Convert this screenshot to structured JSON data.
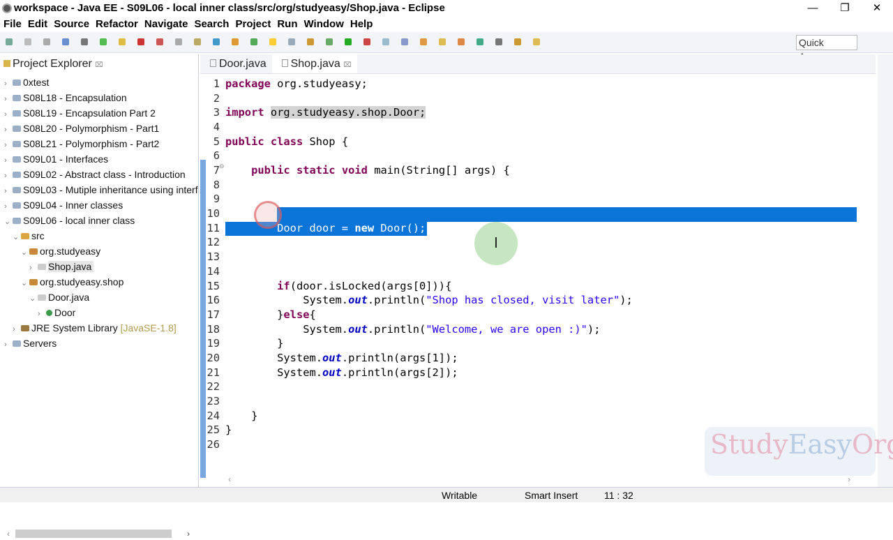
{
  "window": {
    "title": "workspace - Java EE - S09L06 - local inner class/src/org/studyeasy/Shop.java - Eclipse",
    "minimize": "—",
    "maximize": "❐",
    "close": "✕"
  },
  "menu": [
    "File",
    "Edit",
    "Source",
    "Refactor",
    "Navigate",
    "Search",
    "Project",
    "Run",
    "Window",
    "Help"
  ],
  "toolbar": {
    "quick_access": "Quick Access"
  },
  "sidebar": {
    "title": "Project Explorer",
    "close": "⌧",
    "items": [
      {
        "label": "0xtest",
        "level": 0,
        "arrow": "›",
        "icon": "project"
      },
      {
        "label": "S08L18 - Encapsulation",
        "level": 0,
        "arrow": "›",
        "icon": "project"
      },
      {
        "label": "S08L19 - Encapsulation Part 2",
        "level": 0,
        "arrow": "›",
        "icon": "project"
      },
      {
        "label": "S08L20 - Polymorphism - Part1",
        "level": 0,
        "arrow": "›",
        "icon": "project"
      },
      {
        "label": "S08L21 - Polymorphism - Part2",
        "level": 0,
        "arrow": "›",
        "icon": "project"
      },
      {
        "label": "S09L01 - Interfaces",
        "level": 0,
        "arrow": "›",
        "icon": "project"
      },
      {
        "label": "S09L02 - Abstract class - Introduction",
        "level": 0,
        "arrow": "›",
        "icon": "project"
      },
      {
        "label": "S09L03 - Mutiple inheritance using interf",
        "level": 0,
        "arrow": "›",
        "icon": "project"
      },
      {
        "label": "S09L04 - Inner classes",
        "level": 0,
        "arrow": "›",
        "icon": "project"
      },
      {
        "label": "S09L06 - local inner class",
        "level": 0,
        "arrow": "⌄",
        "icon": "project"
      },
      {
        "label": "src",
        "level": 1,
        "arrow": "⌄",
        "icon": "folder"
      },
      {
        "label": "org.studyeasy",
        "level": 2,
        "arrow": "⌄",
        "icon": "package"
      },
      {
        "label": "Shop.java",
        "level": 3,
        "arrow": "›",
        "icon": "java",
        "selected": true
      },
      {
        "label": "org.studyeasy.shop",
        "level": 2,
        "arrow": "⌄",
        "icon": "package"
      },
      {
        "label": "Door.java",
        "level": 3,
        "arrow": "⌄",
        "icon": "java"
      },
      {
        "label": "Door",
        "level": 4,
        "arrow": "›",
        "icon": "class"
      },
      {
        "label": "JRE System Library",
        "suffix": "[JavaSE-1.8]",
        "level": 1,
        "arrow": "›",
        "icon": "library"
      },
      {
        "label": "Servers",
        "level": 0,
        "arrow": "›",
        "icon": "project"
      }
    ]
  },
  "editor": {
    "tabs": [
      {
        "label": "Door.java",
        "active": false
      },
      {
        "label": "Shop.java",
        "active": true,
        "close": "⌧"
      }
    ],
    "lines": [
      [
        [
          "package",
          "kw"
        ],
        [
          " org.studyeasy;",
          ""
        ]
      ],
      [],
      [
        [
          "import",
          "kw"
        ],
        [
          " ",
          ""
        ],
        [
          "org.studyeasy.shop.Door",
          "hl"
        ],
        [
          ";",
          "hl"
        ]
      ],
      [],
      [
        [
          "public",
          "kw"
        ],
        [
          " ",
          ""
        ],
        [
          "class",
          "kw"
        ],
        [
          " Shop {",
          ""
        ]
      ],
      [],
      [
        [
          "    ",
          ""
        ],
        [
          "public",
          "kw"
        ],
        [
          " ",
          ""
        ],
        [
          "static",
          "kw"
        ],
        [
          " ",
          ""
        ],
        [
          "void",
          "kw"
        ],
        [
          " main(String[] args) {",
          ""
        ]
      ],
      [],
      [],
      [],
      [
        [
          "        Door door = ",
          ""
        ],
        [
          "new",
          "kw"
        ],
        [
          " Door();",
          ""
        ]
      ],
      [],
      [],
      [],
      [
        [
          "        ",
          ""
        ],
        [
          "if",
          "kw"
        ],
        [
          "(door.isLocked(args[0])){",
          ""
        ]
      ],
      [
        [
          "            System.",
          ""
        ],
        [
          "out",
          "fld"
        ],
        [
          ".println(",
          ""
        ],
        [
          "\"Shop has closed, visit later\"",
          "str"
        ],
        [
          ");",
          ""
        ]
      ],
      [
        [
          "        }",
          ""
        ],
        [
          "else",
          "kw"
        ],
        [
          "{",
          ""
        ]
      ],
      [
        [
          "            System.",
          ""
        ],
        [
          "out",
          "fld"
        ],
        [
          ".println(",
          ""
        ],
        [
          "\"Welcome, we are open :)\"",
          "str"
        ],
        [
          ");",
          ""
        ]
      ],
      [
        [
          "        }",
          ""
        ]
      ],
      [
        [
          "        System.",
          ""
        ],
        [
          "out",
          "fld"
        ],
        [
          ".println(args[1]);",
          ""
        ]
      ],
      [
        [
          "        System.",
          ""
        ],
        [
          "out",
          "fld"
        ],
        [
          ".println(args[2]);",
          ""
        ]
      ],
      [],
      [],
      [
        [
          "    }",
          ""
        ]
      ],
      [
        [
          "}",
          ""
        ]
      ],
      []
    ],
    "fold_marker_line": 7
  },
  "watermark": {
    "part1": "Study",
    "part2": "Easy",
    "part3": "Org"
  },
  "status": {
    "mode": "Writable",
    "insert": "Smart Insert",
    "position": "11 : 32"
  },
  "colors": {
    "selection": "#0a74d8",
    "keyword": "#7f0055",
    "string": "#2a00ff"
  }
}
